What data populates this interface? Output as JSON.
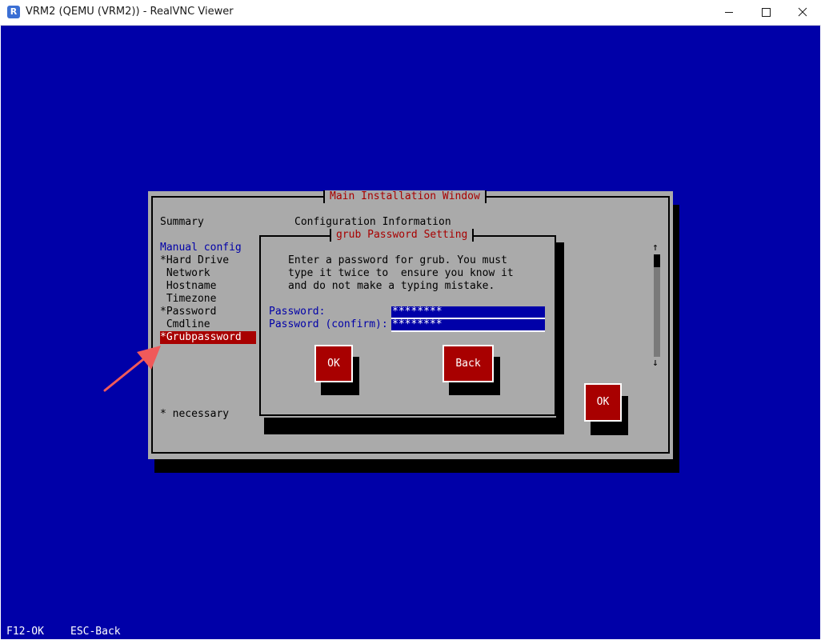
{
  "window": {
    "title": "VRM2 (QEMU (VRM2)) - RealVNC Viewer",
    "icon_name": "realvnc-icon"
  },
  "main_window": {
    "title": "Main Installation Window",
    "summary_label": "Summary",
    "config_info_label": "Configuration Information",
    "manual_config_label": "Manual config",
    "menu_items": [
      "*Hard Drive",
      " Network",
      " Hostname",
      " Timezone",
      "*Password",
      " Cmdline",
      "*Grubpassword"
    ],
    "selected_item": "*Grubpassword",
    "necessary_note": "* necessary",
    "ok_label": "OK",
    "scroll_up": "↑",
    "scroll_down": "↓"
  },
  "grub_dialog": {
    "title": "grub Password Setting",
    "message_lines": [
      "Enter a password for grub. You must",
      "type it twice to  ensure you know it",
      "and do not make a typing mistake."
    ],
    "password_label": "Password:",
    "password_value": "********",
    "confirm_label": "Password (confirm):",
    "confirm_value": "********",
    "ok_label": "OK",
    "back_label": "Back"
  },
  "footer": {
    "f12": "F12-OK",
    "esc": "ESC-Back"
  },
  "colors": {
    "background": "#0000a8",
    "panel": "#aaaaaa",
    "accent": "#a80000",
    "arrow": "#f05a5a"
  }
}
